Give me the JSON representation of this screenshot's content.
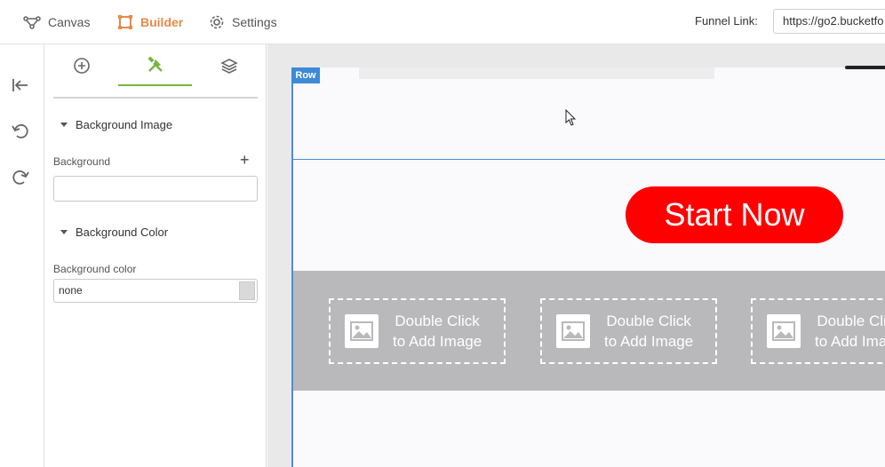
{
  "topbar": {
    "nav": [
      {
        "label": "Canvas",
        "icon": "canvas-icon"
      },
      {
        "label": "Builder",
        "icon": "builder-icon",
        "active": true
      },
      {
        "label": "Settings",
        "icon": "gear-icon"
      }
    ],
    "funnel_label": "Funnel Link:",
    "funnel_url": "https://go2.bucketfo"
  },
  "rail": {
    "icons": [
      "collapse-panel-icon",
      "undo-icon",
      "redo-icon"
    ]
  },
  "panel": {
    "tabs": [
      {
        "icon": "add-element-icon"
      },
      {
        "icon": "tools-icon",
        "active": true
      },
      {
        "icon": "layers-icon"
      }
    ],
    "background_image": {
      "heading": "Background Image",
      "label": "Background",
      "add_symbol": "+",
      "value": ""
    },
    "background_color": {
      "heading": "Background Color",
      "label": "Background color",
      "value": "none"
    }
  },
  "canvas": {
    "row_badge": "Row",
    "cta_label": "Start Now",
    "placeholders": [
      {
        "line1": "Double Click",
        "line2": "to Add Image"
      },
      {
        "line1": "Double Click",
        "line2": "to Add Image"
      },
      {
        "line1": "Double Click",
        "line2": "to Add Image"
      }
    ]
  },
  "colors": {
    "accent_active": "#e8894a",
    "tab_active": "#7cb342",
    "row_outline": "#4a8fd8",
    "cta": "#ff0000"
  }
}
